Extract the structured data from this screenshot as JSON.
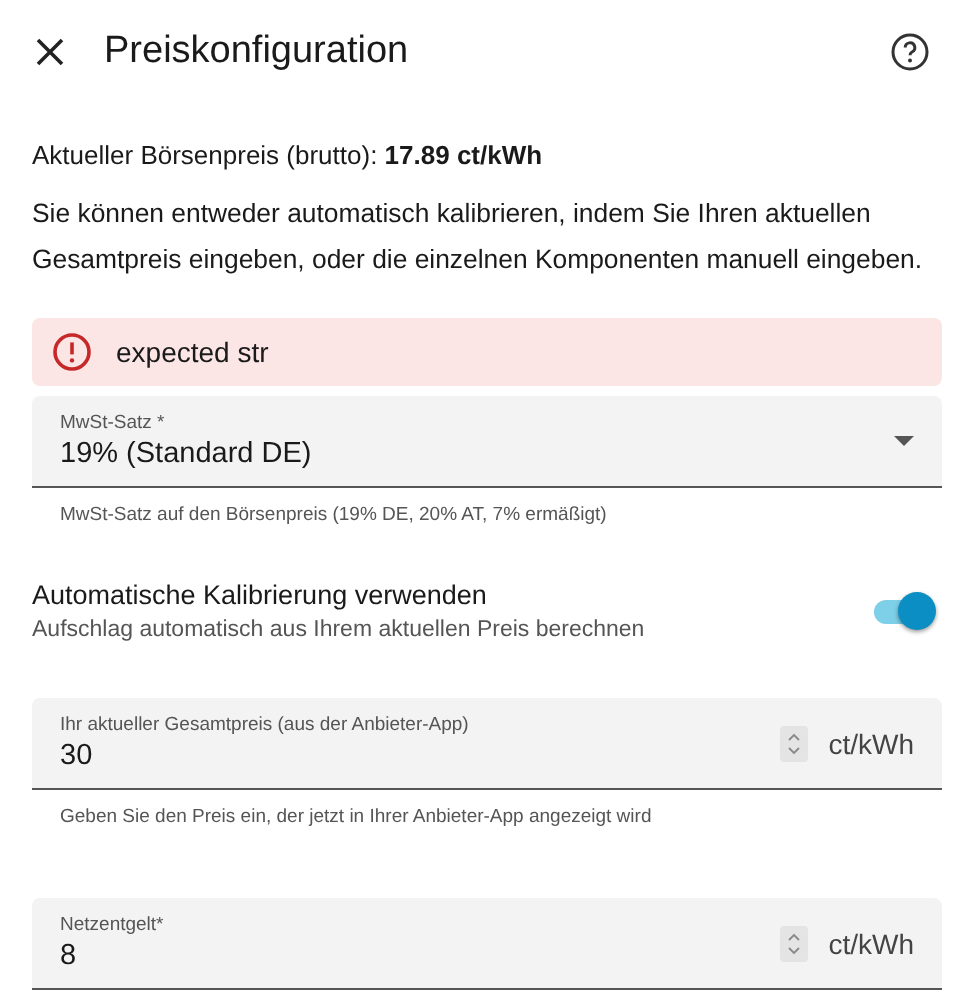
{
  "dialog": {
    "title": "Preiskonfiguration"
  },
  "price_line": "Aktueller Börsenpreis (brutto): **17.89 ct/kWh**",
  "intro": "Sie können entweder automatisch kalibrieren, indem Sie Ihren aktuellen Gesamtpreis eingeben, oder die einzelnen Komponenten manuell eingeben.",
  "error": {
    "message": "expected str"
  },
  "vat_select": {
    "label": "MwSt-Satz *",
    "value": "19% (Standard DE)",
    "helper": "MwSt-Satz auf den Börsenpreis (19% DE, 20% AT, 7% ermäßigt)"
  },
  "auto_calibration": {
    "title": "Automatische Kalibrierung verwenden",
    "description": "Aufschlag automatisch aus Ihrem aktuellen Preis berechnen",
    "on": true
  },
  "fields": [
    {
      "label": "Ihr aktueller Gesamtpreis (aus der Anbieter-App)",
      "value": "30",
      "unit": "ct/kWh",
      "helper": "Geben Sie den Preis ein, der jetzt in Ihrer Anbieter-App angezeigt wird"
    },
    {
      "label": "Netzentgelt*",
      "value": "8",
      "unit": "ct/kWh"
    }
  ]
}
